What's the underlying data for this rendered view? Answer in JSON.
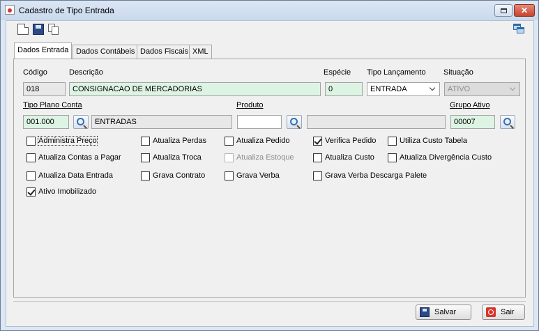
{
  "window": {
    "title": "Cadastro de Tipo Entrada"
  },
  "toolbar": {
    "icons": [
      "new-document-icon",
      "save-disk-icon",
      "copy-icon",
      "windows-cascade-icon"
    ]
  },
  "tabs": [
    {
      "label": "Dados Entrada",
      "active": true
    },
    {
      "label": "Dados Contábeis",
      "active": false
    },
    {
      "label": "Dados Fiscais",
      "active": false
    },
    {
      "label": "XML",
      "active": false
    }
  ],
  "form": {
    "codigo": {
      "label": "Código",
      "value": "018"
    },
    "descricao": {
      "label": "Descrição",
      "value": "CONSIGNACAO DE MERCADORIAS"
    },
    "especie": {
      "label": "Espécie",
      "value": "0"
    },
    "tipo_lancamento": {
      "label": "Tipo Lançamento",
      "value": "ENTRADA"
    },
    "situacao": {
      "label": "Situação",
      "value": "ATIVO"
    },
    "tipo_plano_conta": {
      "label": "Tipo Plano Conta",
      "code": "001.000",
      "description": "ENTRADAS"
    },
    "produto": {
      "label": "Produto",
      "code": "",
      "description": ""
    },
    "grupo_ativo": {
      "label": "Grupo Ativo",
      "code": "00007"
    }
  },
  "checkboxes": [
    {
      "label": "Administra Preço",
      "checked": false,
      "enabled": true
    },
    {
      "label": "Atualiza Perdas",
      "checked": false,
      "enabled": true
    },
    {
      "label": "Atualiza Pedido",
      "checked": false,
      "enabled": true
    },
    {
      "label": "Verifica Pedido",
      "checked": true,
      "enabled": true
    },
    {
      "label": "Utiliza Custo Tabela",
      "checked": false,
      "enabled": true
    },
    {
      "label": "Atualiza Contas a Pagar",
      "checked": false,
      "enabled": true
    },
    {
      "label": "Atualiza Troca",
      "checked": false,
      "enabled": true
    },
    {
      "label": "Atualiza Estoque",
      "checked": false,
      "enabled": false
    },
    {
      "label": "Atualiza Custo",
      "checked": false,
      "enabled": true
    },
    {
      "label": "Atualiza Divergência Custo",
      "checked": false,
      "enabled": true
    },
    {
      "label": "Atualiza Data Entrada",
      "checked": false,
      "enabled": true
    },
    {
      "label": "Grava Contrato",
      "checked": false,
      "enabled": true
    },
    {
      "label": "Grava Verba",
      "checked": false,
      "enabled": true
    },
    {
      "label": "Grava Verba Descarga Palete",
      "checked": false,
      "enabled": true
    },
    {
      "label": "Ativo Imobilizado",
      "checked": true,
      "enabled": true
    }
  ],
  "footer": {
    "save_label": "Salvar",
    "exit_label": "Sair"
  }
}
